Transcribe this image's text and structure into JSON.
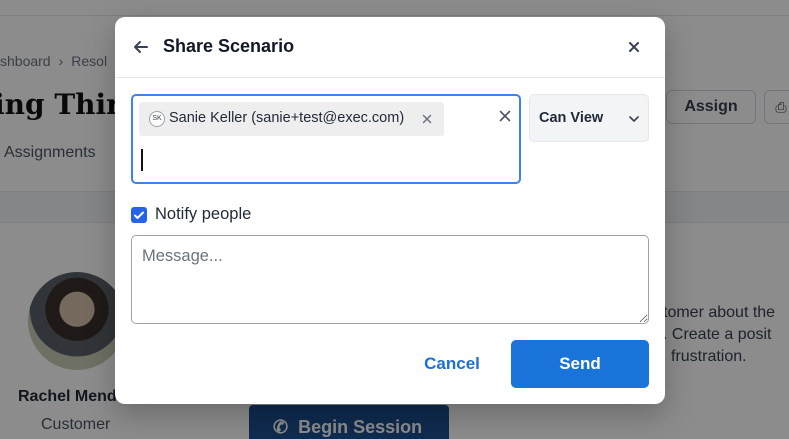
{
  "background": {
    "breadcrumb": {
      "first": "shboard",
      "second": "Resol"
    },
    "page_title": "ing Third-",
    "tab": "Assignments",
    "assign_button": "Assign",
    "participant": {
      "name": "Rachel Mend",
      "role": "Customer"
    },
    "description_lines": [
      "stomer about the",
      "s. Create a posit",
      "frustration."
    ],
    "begin_session_button": "Begin Session"
  },
  "modal": {
    "title": "Share Scenario",
    "recipients": [
      {
        "initials": "SK",
        "label": "Sanie Keller (sanie+test@exec.com)"
      }
    ],
    "recipient_input_value": "",
    "permission": {
      "selected": "Can View"
    },
    "notify": {
      "label": "Notify people",
      "checked": true
    },
    "message": {
      "placeholder": "Message...",
      "value": ""
    },
    "cancel_label": "Cancel",
    "send_label": "Send"
  },
  "colors": {
    "accent": "#1a73d9",
    "focus_border": "#3b82f6",
    "overlay": "rgba(0,0,0,0.45)"
  },
  "icons": [
    "arrow-left-icon",
    "close-icon",
    "chevron-down-icon",
    "check-icon",
    "phone-icon",
    "printer-icon"
  ]
}
